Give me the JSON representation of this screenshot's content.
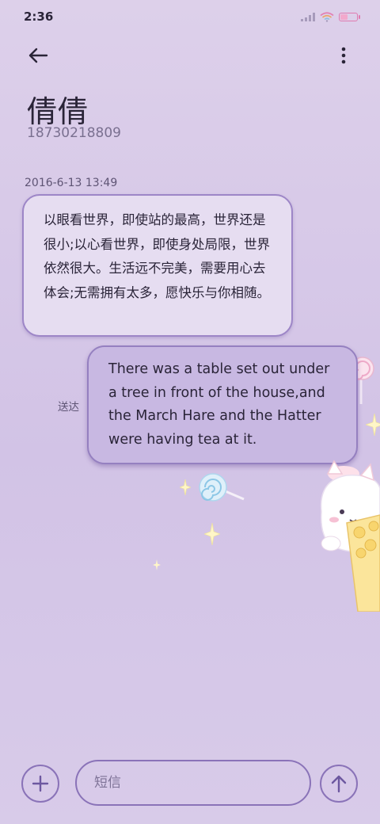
{
  "status_bar": {
    "time": "2:36"
  },
  "header": {
    "back_icon": "arrow-left-icon",
    "more_icon": "more-vertical-icon"
  },
  "contact": {
    "name": "倩倩",
    "number": "18730218809"
  },
  "conversation": {
    "timestamp": "2016-6-13 13:49",
    "messages": [
      {
        "direction": "incoming",
        "text": "以眼看世界，即使站的最高，世界还是很小;以心看世界，即使身处局限，世界依然很大。生活远不完美，需要用心去体会;无需拥有太多，愿快乐与你相随。"
      },
      {
        "direction": "outgoing",
        "status": "送达",
        "text": "There was a table set out under a tree in front of the house,and the March Hare and the Hatter were having tea at it."
      }
    ]
  },
  "composer": {
    "placeholder": "短信",
    "add_icon": "plus-icon",
    "send_icon": "arrow-up-icon"
  },
  "colors": {
    "background": "#d8cbe9",
    "accent": "#8a73b8",
    "incoming_bubble": "#e6ddf1",
    "outgoing_bubble": "#c8b8e2"
  }
}
